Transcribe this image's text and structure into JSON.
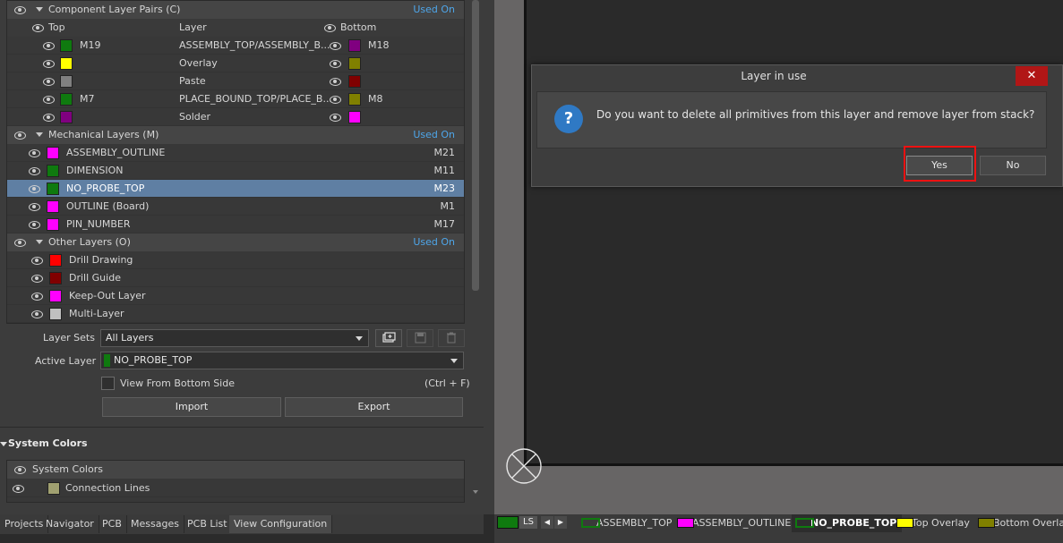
{
  "groups": {
    "component": {
      "title": "Component Layer Pairs (C)",
      "used_on": "Used On",
      "headers": {
        "top": "Top",
        "layer": "Layer",
        "bottom": "Bottom"
      },
      "rows": [
        {
          "top_color": "#0f7a0f",
          "top": "M19",
          "layer": "ASSEMBLY_TOP/ASSEMBLY_B...",
          "bottom_color": "#800080",
          "bottom": "M18"
        },
        {
          "top_color": "#ffff00",
          "top": "",
          "layer": "Overlay",
          "bottom_color": "#808000",
          "bottom": ""
        },
        {
          "top_color": "#808080",
          "top": "",
          "layer": "Paste",
          "bottom_color": "#800000",
          "bottom": ""
        },
        {
          "top_color": "#0f7a0f",
          "top": "M7",
          "layer": "PLACE_BOUND_TOP/PLACE_B...",
          "bottom_color": "#808000",
          "bottom": "M8"
        },
        {
          "top_color": "#800080",
          "top": "",
          "layer": "Solder",
          "bottom_color": "#ff00ff",
          "bottom": ""
        }
      ]
    },
    "mechanical": {
      "title": "Mechanical Layers (M)",
      "used_on": "Used On",
      "rows": [
        {
          "color": "#ff00ff",
          "name": "ASSEMBLY_OUTLINE",
          "code": "M21"
        },
        {
          "color": "#0f7a0f",
          "name": "DIMENSION",
          "code": "M11"
        },
        {
          "color": "#0f7a0f",
          "name": "NO_PROBE_TOP",
          "code": "M23"
        },
        {
          "color": "#ff00ff",
          "name": "OUTLINE (Board)",
          "code": "M1"
        },
        {
          "color": "#ff00ff",
          "name": "PIN_NUMBER",
          "code": "M17"
        }
      ]
    },
    "other": {
      "title": "Other Layers (O)",
      "used_on": "Used On",
      "rows": [
        {
          "color": "#ff0000",
          "name": "Drill Drawing"
        },
        {
          "color": "#800000",
          "name": "Drill Guide"
        },
        {
          "color": "#ff00ff",
          "name": "Keep-Out Layer"
        },
        {
          "color": "#c0c0c0",
          "name": "Multi-Layer"
        }
      ]
    }
  },
  "controls": {
    "layer_sets_label": "Layer Sets",
    "layer_sets_value": "All Layers",
    "active_layer_label": "Active Layer",
    "active_layer_value": "NO_PROBE_TOP",
    "active_layer_color": "#0f7a0f",
    "view_bottom_label": "View From Bottom Side",
    "view_bottom_shortcut": "(Ctrl + F)",
    "import_label": "Import",
    "export_label": "Export"
  },
  "system_colors": {
    "section_title": "System Colors",
    "header": "System Colors",
    "row": "Connection Lines",
    "row_color": "#a0a070"
  },
  "tabs": [
    "Projects",
    "Navigator",
    "PCB",
    "Messages",
    "PCB List",
    "View Configuration"
  ],
  "dialog": {
    "title": "Layer in use",
    "close": "✕",
    "icon": "?",
    "message": "Do you want to delete all primitives from this layer and remove layer from stack?",
    "yes": "Yes",
    "no": "No"
  },
  "status_bar": {
    "ls": "LS",
    "ls_color": "#0f7a0f",
    "layer_tabs": [
      {
        "label": "ASSEMBLY_TOP",
        "color": "#0f7a0f"
      },
      {
        "label": "ASSEMBLY_OUTLINE",
        "color": "#ff00ff"
      },
      {
        "label": "NO_PROBE_TOP",
        "color": "#0f7a0f",
        "active": true
      },
      {
        "label": "Top Overlay",
        "color": "#ffff00"
      },
      {
        "label": "Bottom Overlay",
        "color": "#808000"
      }
    ]
  }
}
